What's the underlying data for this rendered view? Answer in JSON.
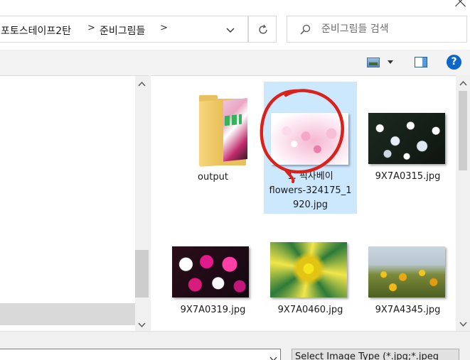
{
  "address_bar": {
    "segments": [
      "포토스테이프2탄",
      "준비그림들"
    ],
    "separator": ">",
    "dropdown_icon": "chevron-down-icon"
  },
  "refresh_icon": "refresh-icon",
  "search": {
    "placeholder": "준비그림들 검색",
    "icon": "search-icon"
  },
  "toolbar": {
    "view_icon": "change-view-icon",
    "preview_icon": "preview-pane-icon",
    "help_label": "?"
  },
  "files": [
    {
      "name": "output",
      "type": "folder"
    },
    {
      "name_lines": [
        "1. 픽사베이",
        "flowers-324175_1",
        "920.jpg"
      ],
      "type": "image",
      "selected": true
    },
    {
      "name": "9X7A0315.jpg",
      "type": "image"
    },
    {
      "name": "9X7A0319.jpg",
      "type": "image"
    },
    {
      "name": "9X7A0460.jpg",
      "type": "image"
    },
    {
      "name": "9X7A4345.jpg",
      "type": "image"
    }
  ],
  "file_type": {
    "selected": "Select Image Type  (*.jpg;*.jpeg"
  },
  "file_name": {
    "value": ""
  },
  "colors": {
    "selection": "#cce8ff",
    "annotation": "#d9221b",
    "help": "#1065c9"
  }
}
